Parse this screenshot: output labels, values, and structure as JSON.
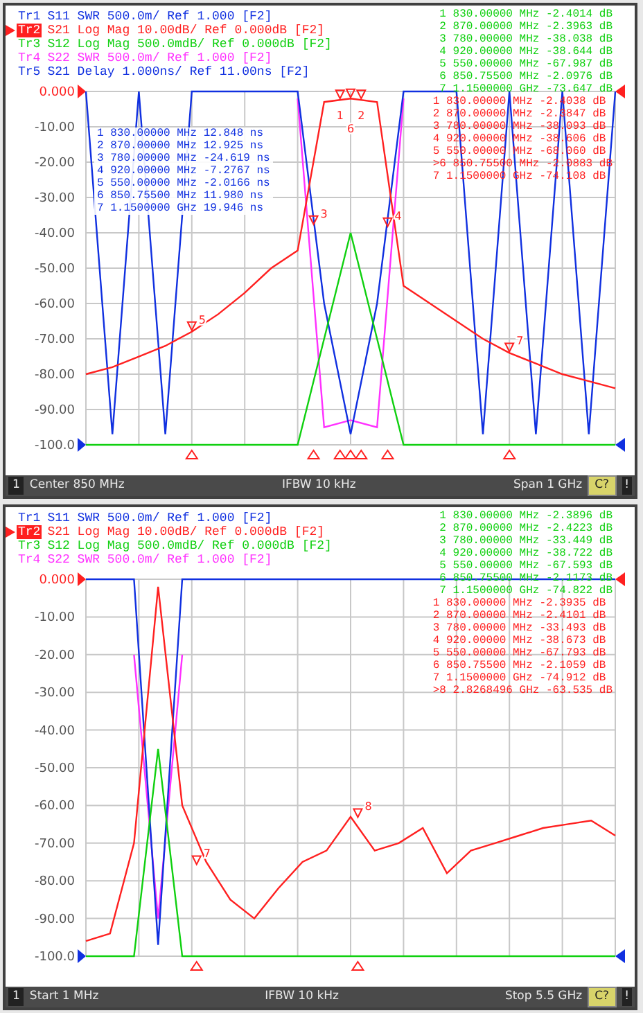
{
  "panels": [
    {
      "legend": [
        {
          "trace": "Tr1",
          "text": "S11 SWR 500.0m/ Ref 1.000 [F2]",
          "color": "#1030e0",
          "active": false
        },
        {
          "trace": "Tr2",
          "text": "S21 Log Mag 10.00dB/ Ref 0.000dB [F2]",
          "color": "#ff2020",
          "active": true
        },
        {
          "trace": "Tr3",
          "text": "S12 Log Mag 500.0mdB/ Ref 0.000dB [F2]",
          "color": "#10d010",
          "active": false
        },
        {
          "trace": "Tr4",
          "text": "S22 SWR 500.0m/ Ref 1.000 [F2]",
          "color": "#ff30ff",
          "active": false
        },
        {
          "trace": "Tr5",
          "text": "S21 Delay 1.000ns/ Ref 11.00ns [F2]",
          "color": "#1030e0",
          "active": false
        }
      ],
      "marker_tables": [
        {
          "kind": "right",
          "color": "#10d010",
          "rows": [
            "1 830.00000 MHz -2.4014 dB",
            "2 870.00000 MHz -2.3963 dB",
            "3 780.00000 MHz -38.038 dB",
            "4 920.00000 MHz -38.644 dB",
            "5 550.00000 MHz -67.987 dB",
            "6 850.75500 MHz -2.0976 dB",
            "7 1.1500000 GHz -73.647 dB"
          ]
        },
        {
          "kind": "right",
          "color": "#ff2020",
          "rows": [
            "1 830.00000 MHz -2.4038 dB",
            "2 870.00000 MHz -2.3847 dB",
            "3 780.00000 MHz -38.093 dB",
            "4 920.00000 MHz -38.606 dB",
            "5 550.00000 MHz -68.060 dB",
            ">6 850.75500 MHz -2.0883 dB",
            "7 1.1500000 GHz -74.108 dB"
          ]
        },
        {
          "kind": "left",
          "color": "#1030e0",
          "rows": [
            "1 830.00000 MHz 12.848 ns",
            "2 870.00000 MHz 12.925 ns",
            "3 780.00000 MHz -24.619 ns",
            "4 920.00000 MHz -7.2767 ns",
            "5 550.00000 MHz -2.0166 ns",
            "6 850.75500 MHz 11.980 ns",
            "7 1.1500000 GHz 19.946 ns"
          ]
        }
      ],
      "chart_data": {
        "type": "line",
        "ylim": [
          -100,
          0
        ],
        "yticks": [
          {
            "value": 0,
            "label": "0.000"
          },
          {
            "value": -10,
            "label": "-10.00"
          },
          {
            "value": -20,
            "label": "-20.00"
          },
          {
            "value": -30,
            "label": "-30.00"
          },
          {
            "value": -40,
            "label": "-40.00"
          },
          {
            "value": -50,
            "label": "-50.00"
          },
          {
            "value": -60,
            "label": "-60.00"
          },
          {
            "value": -70,
            "label": "-70.00"
          },
          {
            "value": -80,
            "label": "-80.00"
          },
          {
            "value": -90,
            "label": "-90.00"
          },
          {
            "value": -100,
            "label": "-100.0"
          }
        ],
        "categories": [
          null,
          null,
          null,
          null,
          null,
          null,
          null,
          null,
          null,
          null,
          null,
          null,
          null,
          null,
          null,
          null,
          null,
          null,
          null,
          null,
          null
        ],
        "series": [
          {
            "color": "#ff30ff",
            "values": [
              null,
              null,
              null,
              null,
              null,
              null,
              null,
              null,
              -2,
              -95,
              -93,
              -95,
              -2,
              null,
              null,
              null,
              null,
              null,
              null,
              null,
              null
            ]
          },
          {
            "color": "#1030e0",
            "values": [
              0,
              -97,
              0,
              -97,
              0,
              0,
              0,
              0,
              0,
              -60,
              -97,
              -60,
              0,
              0,
              0,
              -97,
              0,
              -97,
              0,
              -97,
              0
            ]
          },
          {
            "color": "#10d010",
            "values": [
              -100,
              -100,
              -100,
              -100,
              -100,
              -100,
              -100,
              -100,
              -100,
              -70,
              -40,
              -70,
              -100,
              -100,
              -100,
              -100,
              -100,
              -100,
              -100,
              -100,
              -100
            ]
          },
          {
            "color": "#ff2020",
            "values": [
              -80,
              -78,
              -75,
              -72,
              -68,
              -63,
              -57,
              -50,
              -45,
              -3,
              -2,
              -3,
              -55,
              -60,
              -65,
              -70,
              -74,
              -77,
              -80,
              -82,
              -84
            ]
          }
        ],
        "grid": true,
        "annotations": [
          "1",
          "2",
          "6",
          "3",
          "4",
          "5",
          "7"
        ]
      },
      "status": {
        "channel": "1",
        "left": "Center 850 MHz",
        "middle": "IFBW 10 kHz",
        "right": "Span 1 GHz",
        "badge": "C?",
        "alert": "!"
      }
    },
    {
      "legend": [
        {
          "trace": "Tr1",
          "text": "S11 SWR 500.0m/ Ref 1.000 [F2]",
          "color": "#1030e0",
          "active": false
        },
        {
          "trace": "Tr2",
          "text": "S21 Log Mag 10.00dB/ Ref 0.000dB [F2]",
          "color": "#ff2020",
          "active": true
        },
        {
          "trace": "Tr3",
          "text": "S12 Log Mag 500.0mdB/ Ref 0.000dB [F2]",
          "color": "#10d010",
          "active": false
        },
        {
          "trace": "Tr4",
          "text": "S22 SWR 500.0m/ Ref 1.000 [F2]",
          "color": "#ff30ff",
          "active": false
        }
      ],
      "marker_tables": [
        {
          "kind": "right",
          "color": "#10d010",
          "rows": [
            "1 830.00000 MHz -2.3896 dB",
            "2 870.00000 MHz -2.4223 dB",
            "3 780.00000 MHz -33.449 dB",
            "4 920.00000 MHz -38.722 dB",
            "5 550.00000 MHz -67.593 dB",
            "6 850.75500 MHz -2.1173 dB",
            "7 1.1500000 GHz -74.822 dB"
          ]
        },
        {
          "kind": "right",
          "color": "#ff2020",
          "rows": [
            "1 830.00000 MHz -2.3935 dB",
            "2 870.00000 MHz -2.4101 dB",
            "3 780.00000 MHz -33.493 dB",
            "4 920.00000 MHz -38.673 dB",
            "5 550.00000 MHz -67.793 dB",
            "6 850.75500 MHz -2.1059 dB",
            "7 1.1500000 GHz -74.912 dB",
            ">8 2.8268496 GHz -63.535 dB"
          ]
        }
      ],
      "chart_data": {
        "type": "line",
        "ylim": [
          -100,
          0
        ],
        "yticks": [
          {
            "value": 0,
            "label": "0.000"
          },
          {
            "value": -10,
            "label": "-10.00"
          },
          {
            "value": -20,
            "label": "-20.00"
          },
          {
            "value": -30,
            "label": "-30.00"
          },
          {
            "value": -40,
            "label": "-40.00"
          },
          {
            "value": -50,
            "label": "-50.00"
          },
          {
            "value": -60,
            "label": "-60.00"
          },
          {
            "value": -70,
            "label": "-70.00"
          },
          {
            "value": -80,
            "label": "-80.00"
          },
          {
            "value": -90,
            "label": "-90.00"
          },
          {
            "value": -100,
            "label": "-100.0"
          }
        ],
        "categories": [
          null,
          null,
          null,
          null,
          null,
          null,
          null,
          null,
          null,
          null,
          null,
          null,
          null,
          null,
          null,
          null,
          null,
          null,
          null,
          null,
          null,
          null,
          null
        ],
        "series": [
          {
            "color": "#ff30ff",
            "values": [
              null,
              null,
              -20,
              -90,
              -20,
              null,
              null,
              null,
              null,
              null,
              null,
              null,
              null,
              null,
              null,
              null,
              null,
              null,
              null,
              null,
              null,
              null,
              null
            ]
          },
          {
            "color": "#1030e0",
            "values": [
              0,
              0,
              0,
              -97,
              0,
              0,
              0,
              0,
              0,
              0,
              0,
              0,
              0,
              0,
              0,
              0,
              0,
              0,
              0,
              0,
              0,
              0,
              0
            ]
          },
          {
            "color": "#10d010",
            "values": [
              -100,
              -100,
              -100,
              -45,
              -100,
              -100,
              -100,
              -100,
              -100,
              -100,
              -100,
              -100,
              -100,
              -100,
              -100,
              -100,
              -100,
              -100,
              -100,
              -100,
              -100,
              -100,
              -100
            ]
          },
          {
            "color": "#ff2020",
            "values": [
              -96,
              -94,
              -70,
              -2,
              -60,
              -75,
              -85,
              -90,
              -82,
              -75,
              -72,
              -63,
              -72,
              -70,
              -66,
              -78,
              -72,
              -70,
              -68,
              -66,
              -65,
              -64,
              -68
            ]
          }
        ],
        "grid": true,
        "annotations": [
          "7",
          "8"
        ]
      },
      "status": {
        "channel": "1",
        "left": "Start 1 MHz",
        "middle": "IFBW 10 kHz",
        "right": "Stop 5.5 GHz",
        "badge": "C?",
        "alert": "!"
      }
    }
  ]
}
